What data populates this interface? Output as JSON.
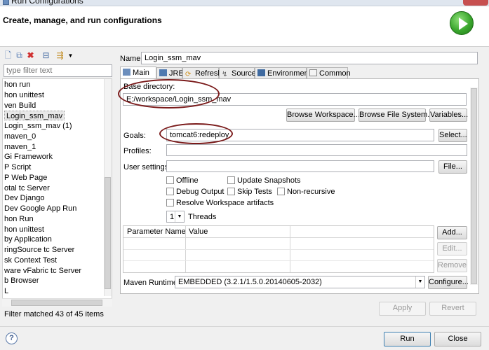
{
  "window": {
    "title": "Run Configurations"
  },
  "header": {
    "title": "Create, manage, and run configurations"
  },
  "filter": {
    "placeholder": "type filter text"
  },
  "tree_items": [
    "hon run",
    "hon unittest",
    "ven Build",
    "Login_ssm_mav",
    "Login_ssm_mav (1)",
    "maven_0",
    "maven_1",
    "Gi Framework",
    "P Script",
    "P Web Page",
    "otal tc Server",
    "Dev Django",
    "Dev Google App Run",
    "hon Run",
    "hon unittest",
    "by Application",
    "ringSource tc Server",
    "sk Context Test",
    "ware vFabric tc Server",
    "b Browser",
    "L"
  ],
  "status": {
    "matched": "Filter matched 43 of 45 items"
  },
  "config": {
    "name_label": "Name:",
    "name_value": "Login_ssm_mav",
    "tabs": [
      "Main",
      "JRE",
      "Refresh",
      "Source",
      "Environment",
      "Common"
    ],
    "base_dir_label": "Base directory:",
    "base_dir_value": "E:/workspace/Login_ssm_mav",
    "browse_workspace": "Browse Workspace...",
    "browse_fs": "Browse File System...",
    "variables": "Variables...",
    "goals_label": "Goals:",
    "goals_value": "tomcat6:redeploy",
    "select": "Select...",
    "profiles_label": "Profiles:",
    "user_settings_label": "User settings:",
    "file": "File...",
    "checks": {
      "offline": "Offline",
      "update_snapshots": "Update Snapshots",
      "debug_output": "Debug Output",
      "skip_tests": "Skip Tests",
      "non_recursive": "Non-recursive",
      "resolve_workspace": "Resolve Workspace artifacts"
    },
    "threads_value": "1",
    "threads_label": "Threads",
    "param_headers": [
      "Parameter Name",
      "Value"
    ],
    "add": "Add...",
    "edit": "Edit...",
    "remove": "Remove",
    "runtime_label": "Maven Runtime:",
    "runtime_value": "EMBEDDED (3.2.1/1.5.0.20140605-2032)",
    "configure": "Configure...",
    "apply": "Apply",
    "revert": "Revert"
  },
  "footer": {
    "help": "?",
    "run": "Run",
    "close": "Close"
  }
}
